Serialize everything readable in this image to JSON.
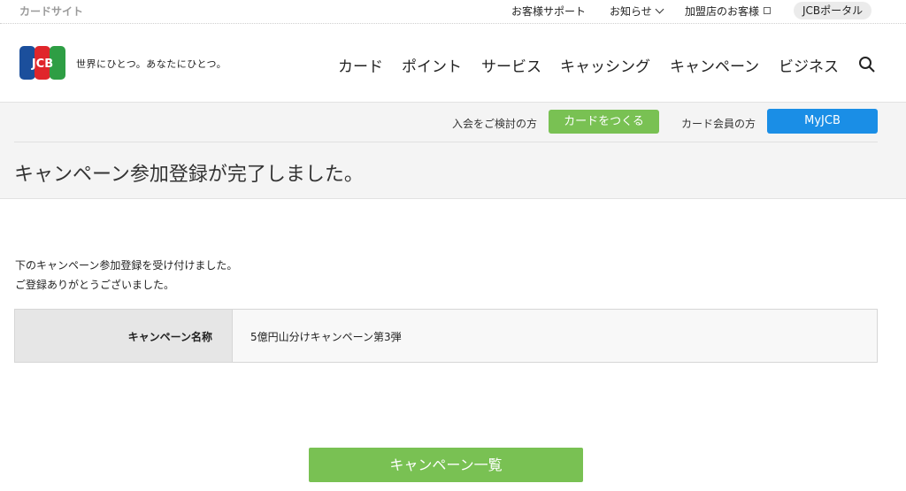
{
  "topbar": {
    "site_label": "カードサイト",
    "support": "お客様サポート",
    "news": "お知らせ",
    "merchant": "加盟店のお客様",
    "portal": "JCBポータル"
  },
  "header": {
    "logo_text": "JCB",
    "tagline": "世界にひとつ。あなたにひとつ。",
    "nav": [
      "カード",
      "ポイント",
      "サービス",
      "キャッシング",
      "キャンペーン",
      "ビジネス"
    ]
  },
  "band": {
    "join_label": "入会をご検討の方",
    "make_card_button": "カードをつくる",
    "member_label": "カード会員の方",
    "myjcb_button": "MyJCB"
  },
  "page_title": "キャンペーン参加登録が完了しました。",
  "messages": [
    "下のキャンペーン参加登録を受け付けました。",
    "ご登録ありがとうございました。"
  ],
  "table": {
    "header": "キャンペーン名称",
    "value": "5億円山分けキャンペーン第3弾"
  },
  "list_button": "キャンペーン一覧",
  "colors": {
    "green": "#79c153",
    "blue": "#1a8ee6",
    "logo_blue": "#1b4f9c",
    "logo_red": "#e0262b",
    "logo_green": "#2e9e44"
  }
}
